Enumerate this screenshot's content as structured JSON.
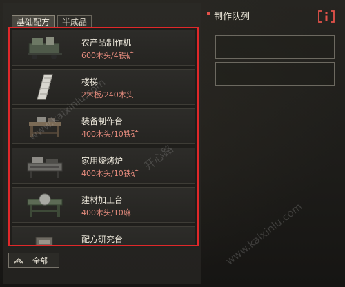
{
  "tabs": [
    {
      "label": "基础配方",
      "active": true
    },
    {
      "label": "半成品",
      "active": false
    }
  ],
  "queue": {
    "title": "制作队列",
    "info_icon": "info-icon"
  },
  "recipes": [
    {
      "name": "农产品制作机",
      "cost": "600木头/4铁矿",
      "icon": "farm-machine-icon"
    },
    {
      "name": "楼梯",
      "cost": "2木板/240木头",
      "icon": "ladder-icon"
    },
    {
      "name": "装备制作台",
      "cost": "400木头/10铁矿",
      "icon": "workbench-icon"
    },
    {
      "name": "家用烧烤炉",
      "cost": "400木头/10铁矿",
      "icon": "grill-icon"
    },
    {
      "name": "建材加工台",
      "cost": "400木头/10麻",
      "icon": "saw-table-icon"
    },
    {
      "name": "配方研究台",
      "cost": "",
      "icon": "research-table-icon"
    }
  ],
  "filter": {
    "label": "全部",
    "icon": "filter-chevron-icon"
  },
  "watermarks": {
    "domain": "www.kaixinlu.com",
    "brand": "开心路"
  },
  "colors": {
    "highlight_border": "#e0282a",
    "cost_text": "#e38a7c",
    "info_accent": "#e4524a"
  }
}
